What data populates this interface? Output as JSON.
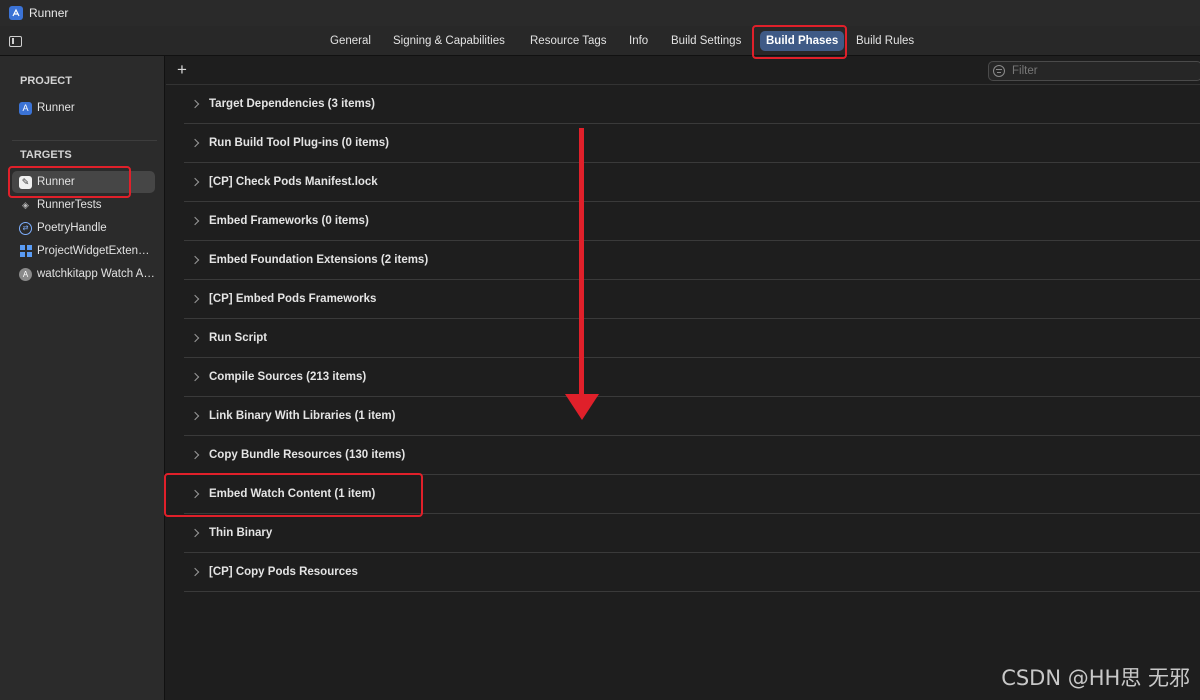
{
  "window": {
    "title": "Runner"
  },
  "tabs": [
    {
      "label": "General"
    },
    {
      "label": "Signing & Capabilities"
    },
    {
      "label": "Resource Tags"
    },
    {
      "label": "Info"
    },
    {
      "label": "Build Settings"
    },
    {
      "label": "Build Phases",
      "active": true
    },
    {
      "label": "Build Rules"
    }
  ],
  "sidebar": {
    "project_title": "PROJECT",
    "project_items": [
      {
        "label": "Runner",
        "icon": "xcode-project-icon"
      }
    ],
    "targets_title": "TARGETS",
    "target_items": [
      {
        "label": "Runner",
        "icon": "app-target-icon",
        "selected": true
      },
      {
        "label": "RunnerTests",
        "icon": "test-target-icon"
      },
      {
        "label": "PoetryHandle",
        "icon": "extension-target-icon"
      },
      {
        "label": "ProjectWidgetExtension",
        "icon": "widget-target-icon"
      },
      {
        "label": "watchkitapp Watch App",
        "icon": "watch-app-icon"
      }
    ]
  },
  "main": {
    "filter_placeholder": "Filter",
    "phases": [
      {
        "title": "Target Dependencies (3 items)"
      },
      {
        "title": "Run Build Tool Plug-ins (0 items)"
      },
      {
        "title": "[CP] Check Pods Manifest.lock"
      },
      {
        "title": "Embed Frameworks (0 items)"
      },
      {
        "title": "Embed Foundation Extensions (2 items)"
      },
      {
        "title": "[CP] Embed Pods Frameworks"
      },
      {
        "title": "Run Script"
      },
      {
        "title": "Compile Sources (213 items)"
      },
      {
        "title": "Link Binary With Libraries (1 item)"
      },
      {
        "title": "Copy Bundle Resources (130 items)"
      },
      {
        "title": "Embed Watch Content (1 item)"
      },
      {
        "title": "Thin Binary"
      },
      {
        "title": "[CP] Copy Pods Resources"
      }
    ]
  },
  "colors": {
    "highlight": "#e0202a",
    "active_tab": "#3f5a86"
  },
  "watermark": "CSDN @HH思 无邪"
}
